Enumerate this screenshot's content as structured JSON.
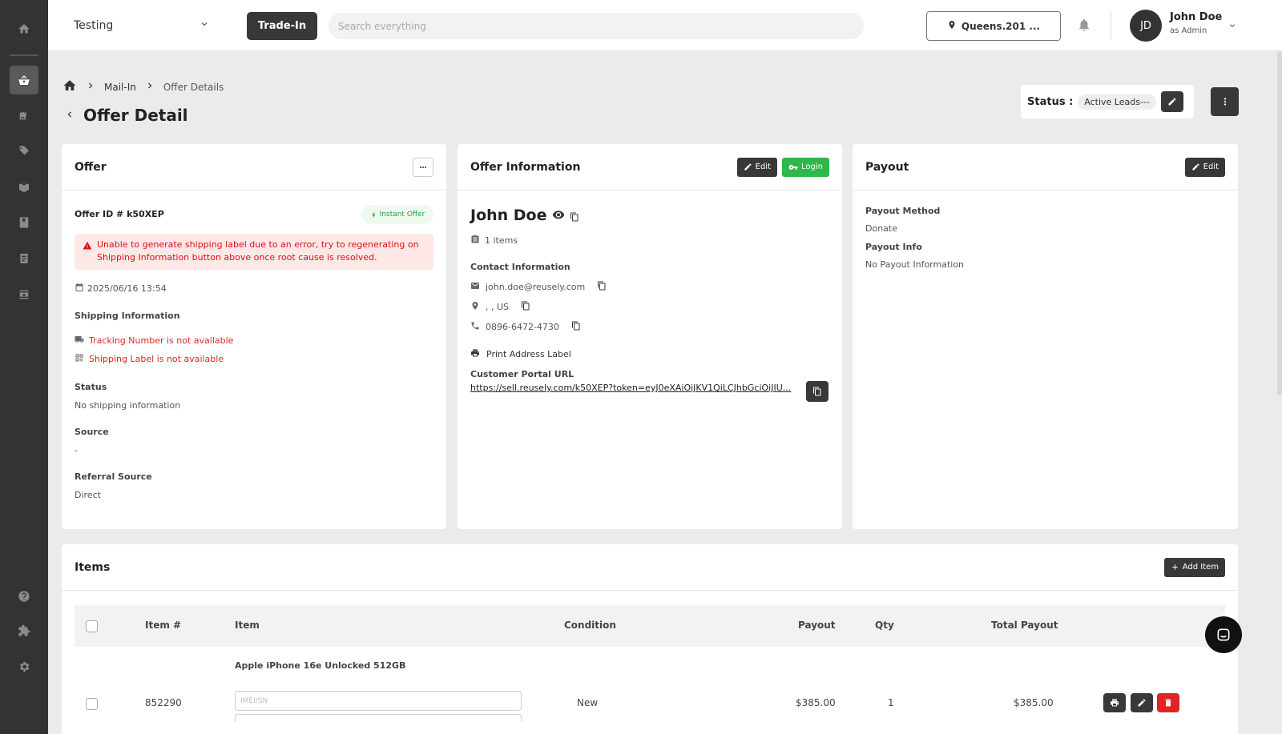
{
  "topbar": {
    "store_name": "Testing",
    "tradein_label": "Trade-In",
    "search_placeholder": "Search everything",
    "location_label": "Queens.201 ...",
    "avatar_initials": "JD",
    "user_name": "John Doe",
    "user_role": "as Admin"
  },
  "breadcrumb": {
    "items": [
      "Mail-In",
      "Offer Details"
    ]
  },
  "page": {
    "title": "Offer Detail",
    "status_label": "Status :",
    "status_value": "Active Leads---"
  },
  "offer_card": {
    "title": "Offer",
    "offer_id": "Offer ID # k50XEP",
    "instant_badge": "Instant Offer",
    "alert_text": "Unable to generate shipping label due to an error, try to regenerating on Shipping Information button above once root cause is resolved.",
    "date": "2025/06/16 13:54",
    "shipping_label": "Shipping Information",
    "tracking_text": "Tracking Number is not available",
    "shipping_label_text": "Shipping Label is not available",
    "status_label": "Status",
    "status_value": "No shipping information",
    "source_label": "Source",
    "source_value": "-",
    "referral_label": "Referral Source",
    "referral_value": "Direct"
  },
  "info_card": {
    "title": "Offer Information",
    "edit_label": "Edit",
    "login_label": "Login",
    "customer_name": "John Doe",
    "items_count": "1 items",
    "contact_label": "Contact Information",
    "email": "john.doe@reusely.com",
    "address": ", , US",
    "phone": "0896-6472-4730",
    "print_label": "Print Address Label",
    "portal_label": "Customer Portal URL",
    "portal_url": "https://sell.reusely.com/k50XEP?token=eyJ0eXAiOiJKV1QiLCJhbGciOiJIU..."
  },
  "payout_card": {
    "title": "Payout",
    "edit_label": "Edit",
    "method_label": "Payout Method",
    "method_value": "Donate",
    "info_label": "Payout Info",
    "info_value": "No Payout Information"
  },
  "items_card": {
    "title": "Items",
    "add_label": "Add Item",
    "columns": [
      "Item #",
      "Item",
      "Condition",
      "Payout",
      "Qty",
      "Total Payout"
    ],
    "group_name": "Apple iPhone 16e Unlocked 512GB",
    "rows": [
      {
        "item_no": "852290",
        "imei_placeholder": "IMEI/SN",
        "condition": "New",
        "payout": "$385.00",
        "qty": "1",
        "total": "$385.00"
      }
    ]
  },
  "colors": {
    "sidebar": "#333333",
    "dark_button": "#383838",
    "green": "#2cb84a",
    "danger": "#e02424",
    "alert_bg": "#fde8e8"
  }
}
